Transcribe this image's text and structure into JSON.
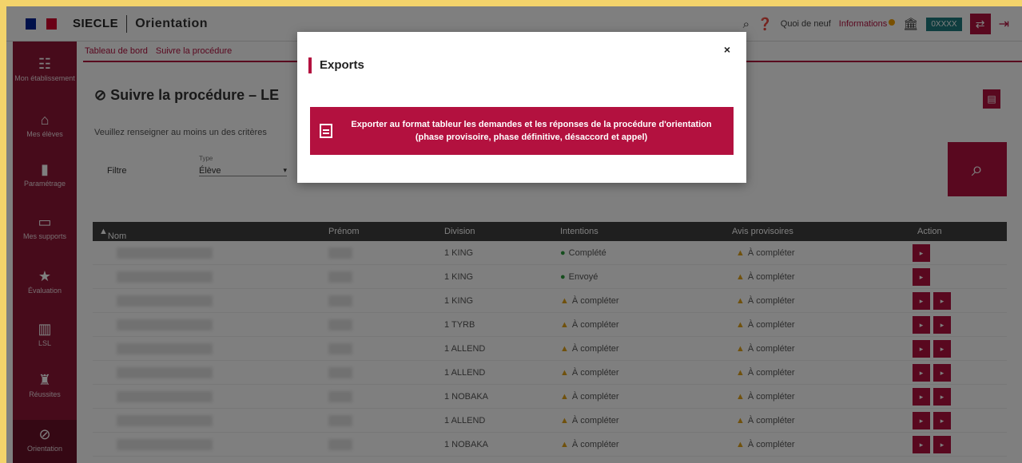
{
  "header": {
    "brand": "SIECLE",
    "module": "Orientation",
    "links": [
      "Quoi de neuf",
      "Informations"
    ],
    "uai": "0XXXX"
  },
  "sidebar": {
    "items": [
      {
        "label": "Mon établissement",
        "icon": "org-icon"
      },
      {
        "label": "Mes élèves",
        "icon": "building-icon"
      },
      {
        "label": "Paramétrage",
        "icon": "book-icon"
      },
      {
        "label": "Mes supports",
        "icon": "screen-icon"
      },
      {
        "label": "Évaluation",
        "icon": "star-icon"
      },
      {
        "label": "LSL",
        "icon": "open-book-icon"
      },
      {
        "label": "Réussites",
        "icon": "trophy-icon"
      },
      {
        "label": "Orientation",
        "icon": "compass-icon"
      }
    ]
  },
  "breadcrumb": {
    "items": [
      "Tableau de bord",
      "Suivre la procédure"
    ]
  },
  "page": {
    "title": "Suivre la procédure – LE",
    "instruction": "Veuillez renseigner au moins un des critères",
    "filter_label": "Filtre",
    "filter_field_label": "Type",
    "filter_value": "Élève"
  },
  "table": {
    "headers": {
      "nom": "Nom",
      "prenom": "Prénom",
      "division": "Division",
      "intentions": "Intentions",
      "avis": "Avis provisoires",
      "action": "Action"
    },
    "rows": [
      {
        "division": "1 KING",
        "intentions": "Complété",
        "intentions_status": "ok",
        "avis": "À compléter",
        "actions": 1
      },
      {
        "division": "1 KING",
        "intentions": "Envoyé",
        "intentions_status": "ok",
        "avis": "À compléter",
        "actions": 1
      },
      {
        "division": "1 KING",
        "intentions": "À compléter",
        "intentions_status": "warn",
        "avis": "À compléter",
        "actions": 2
      },
      {
        "division": "1 TYRB",
        "intentions": "À compléter",
        "intentions_status": "warn",
        "avis": "À compléter",
        "actions": 2
      },
      {
        "division": "1 ALLEND",
        "intentions": "À compléter",
        "intentions_status": "warn",
        "avis": "À compléter",
        "actions": 2
      },
      {
        "division": "1 ALLEND",
        "intentions": "À compléter",
        "intentions_status": "warn",
        "avis": "À compléter",
        "actions": 2
      },
      {
        "division": "1 NOBAKA",
        "intentions": "À compléter",
        "intentions_status": "warn",
        "avis": "À compléter",
        "actions": 2
      },
      {
        "division": "1 ALLEND",
        "intentions": "À compléter",
        "intentions_status": "warn",
        "avis": "À compléter",
        "actions": 2
      },
      {
        "division": "1 NOBAKA",
        "intentions": "À compléter",
        "intentions_status": "warn",
        "avis": "À compléter",
        "actions": 2
      }
    ]
  },
  "modal": {
    "title": "Exports",
    "close": "×",
    "export_button_label": "Exporter au format tableur les demandes et les réponses de la procédure d'orientation (phase provisoire, phase définitive, désaccord et appel)"
  }
}
